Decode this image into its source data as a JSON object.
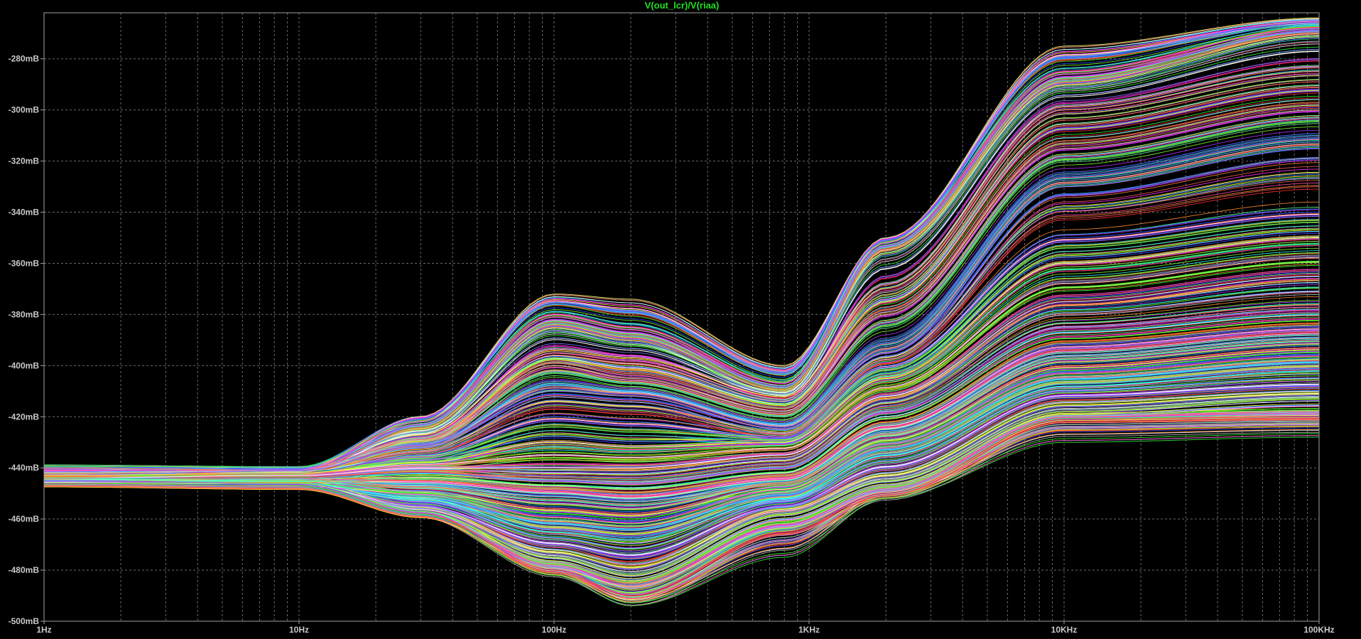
{
  "chart_data": {
    "type": "line",
    "title": "V(out_lcr)/V(riaa)",
    "title_color": "#22e022",
    "background": "#000000",
    "axis_color": "#a0a0a0",
    "grid": true,
    "grid_style": "dashed",
    "x_scale": "log",
    "x_unit": "Hz",
    "xlim": [
      1,
      100000
    ],
    "xticks": [
      1,
      10,
      100,
      1000,
      10000,
      100000
    ],
    "xtick_labels": [
      "1Hz",
      "10Hz",
      "100Hz",
      "1KHz",
      "10KHz",
      "100KHz"
    ],
    "y_unit": "dB",
    "ylim": [
      -500,
      -262
    ],
    "yticks": [
      -500,
      -480,
      -460,
      -440,
      -420,
      -400,
      -380,
      -360,
      -340,
      -320,
      -300,
      -280
    ],
    "ytick_labels": [
      "-500mB",
      "-480mB",
      "-460mB",
      "-440mB",
      "-420mB",
      "-400mB",
      "-380mB",
      "-360mB",
      "-340mB",
      "-320mB",
      "-300mB",
      "-280mB"
    ],
    "series_count": 600,
    "series_colors": [
      "#ff3030",
      "#30ff30",
      "#3050ff",
      "#ff30ff",
      "#30ffff",
      "#ffff30",
      "#ff8c30",
      "#b030ff",
      "#ffffff",
      "#ff4fa0",
      "#80ff30",
      "#3090ff",
      "#c0c0c0",
      "#ff6060",
      "#60ff90",
      "#8080ff"
    ],
    "x": [
      1,
      10,
      30,
      100,
      200,
      800,
      2000,
      10000,
      100000
    ],
    "series": [
      {
        "values": [
          -442,
          -441,
          -420,
          -372,
          -374,
          -400,
          -350,
          -275,
          -264
        ]
      },
      {
        "values": [
          -441,
          -441,
          -422,
          -380,
          -385,
          -407,
          -352,
          -285,
          -268
        ]
      },
      {
        "values": [
          -440,
          -441,
          -425,
          -385,
          -390,
          -410,
          -355,
          -290,
          -270
        ]
      },
      {
        "values": [
          -441,
          -441,
          -428,
          -395,
          -398,
          -413,
          -370,
          -300,
          -285
        ]
      },
      {
        "values": [
          -442,
          -441,
          -430,
          -400,
          -405,
          -418,
          -380,
          -315,
          -300
        ]
      },
      {
        "values": [
          -443,
          -441,
          -432,
          -410,
          -412,
          -425,
          -395,
          -330,
          -315
        ]
      },
      {
        "values": [
          -443,
          -442,
          -435,
          -420,
          -422,
          -428,
          -400,
          -350,
          -340
        ]
      },
      {
        "values": [
          -443,
          -442,
          -438,
          -430,
          -432,
          -430,
          -405,
          -360,
          -350
        ]
      },
      {
        "values": [
          -444,
          -443,
          -440,
          -440,
          -440,
          -435,
          -412,
          -375,
          -365
        ]
      },
      {
        "values": [
          -444,
          -444,
          -442,
          -445,
          -446,
          -440,
          -418,
          -385,
          -378
        ]
      },
      {
        "values": [
          -444,
          -445,
          -446,
          -450,
          -452,
          -445,
          -425,
          -395,
          -388
        ]
      },
      {
        "values": [
          -445,
          -446,
          -450,
          -458,
          -460,
          -448,
          -430,
          -402,
          -395
        ]
      },
      {
        "values": [
          -445,
          -446,
          -452,
          -465,
          -468,
          -452,
          -435,
          -408,
          -402
        ]
      },
      {
        "values": [
          -445,
          -446,
          -455,
          -470,
          -475,
          -455,
          -440,
          -412,
          -408
        ]
      },
      {
        "values": [
          -446,
          -446,
          -457,
          -475,
          -482,
          -458,
          -445,
          -418,
          -413
        ]
      },
      {
        "values": [
          -446,
          -447,
          -458,
          -478,
          -485,
          -462,
          -448,
          -420,
          -418
        ]
      },
      {
        "values": [
          -446,
          -447,
          -458,
          -480,
          -490,
          -465,
          -450,
          -421,
          -420
        ]
      },
      {
        "values": [
          -446,
          -447,
          -458,
          -482,
          -494,
          -475,
          -452,
          -430,
          -428
        ]
      }
    ]
  }
}
